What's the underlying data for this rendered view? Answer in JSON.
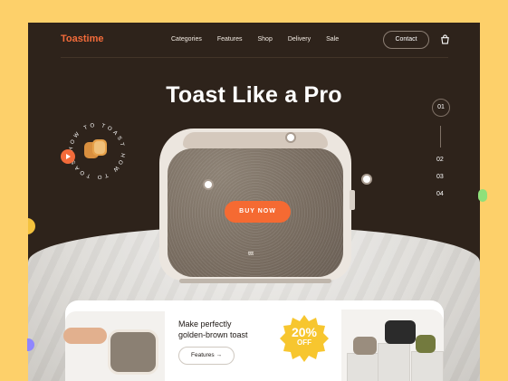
{
  "brand": "Toastime",
  "nav": {
    "links": [
      "Categories",
      "Features",
      "Shop",
      "Delivery",
      "Sale"
    ],
    "contact": "Contact"
  },
  "hero": {
    "headline": "Toast Like a Pro",
    "buy_label": "BUY NOW",
    "badge_text": "HOW TO TOAST HOW TO TOAST",
    "product_mark": "ttt"
  },
  "slides": {
    "active": "01",
    "items": [
      "02",
      "03",
      "04"
    ]
  },
  "promo": {
    "line1": "Make perfectly",
    "line2": "golden-brown toast",
    "button": "Features",
    "offer_value": "20%",
    "offer_label": "OFF"
  },
  "colors": {
    "accent": "#f56a32",
    "background": "#fdd06a",
    "dark": "#2e231b"
  }
}
